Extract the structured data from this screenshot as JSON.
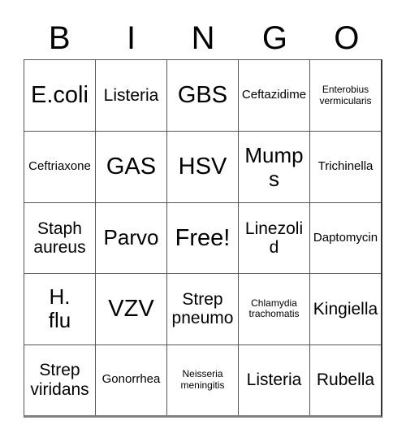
{
  "card": {
    "title": "BINGO",
    "headers": [
      "B",
      "I",
      "N",
      "G",
      "O"
    ],
    "free_space_label": "Free!",
    "rows": [
      [
        {
          "text": "E.coli",
          "size": "xl"
        },
        {
          "text": "Listeria",
          "size": "md"
        },
        {
          "text": "GBS",
          "size": "xl"
        },
        {
          "text": "Ceftazidime",
          "size": "sm"
        },
        {
          "text": "Enterobius\nvermicularis",
          "size": "xs"
        }
      ],
      [
        {
          "text": "Ceftriaxone",
          "size": "sm"
        },
        {
          "text": "GAS",
          "size": "xl"
        },
        {
          "text": "HSV",
          "size": "xl"
        },
        {
          "text": "Mumps",
          "size": "lg"
        },
        {
          "text": "Trichinella",
          "size": "sm"
        }
      ],
      [
        {
          "text": "Staph\naureus",
          "size": "md"
        },
        {
          "text": "Parvo",
          "size": "lg"
        },
        {
          "text": "Free!",
          "size": "xl"
        },
        {
          "text": "Linezolid",
          "size": "md"
        },
        {
          "text": "Daptomycin",
          "size": "sm"
        }
      ],
      [
        {
          "text": "H.\nflu",
          "size": "lg"
        },
        {
          "text": "VZV",
          "size": "xl"
        },
        {
          "text": "Strep\npneumo",
          "size": "md"
        },
        {
          "text": "Chlamydia\ntrachomatis",
          "size": "xs"
        },
        {
          "text": "Kingiella",
          "size": "md"
        }
      ],
      [
        {
          "text": "Strep\nviridans",
          "size": "md"
        },
        {
          "text": "Gonorrhea",
          "size": "sm"
        },
        {
          "text": "Neisseria\nmeningitis",
          "size": "xs"
        },
        {
          "text": "Listeria",
          "size": "md"
        },
        {
          "text": "Rubella",
          "size": "md"
        }
      ]
    ]
  },
  "colors": {
    "background": "#ffffff",
    "text": "#000000",
    "grid_line": "#555555",
    "grid_border": "#333333",
    "grid_shadow": "#808080"
  }
}
